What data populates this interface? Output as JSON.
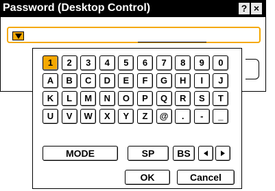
{
  "dialog": {
    "title": "Password (Desktop Control)",
    "help_label": "?",
    "close_label": "×"
  },
  "keyboard": {
    "row1": [
      "1",
      "2",
      "3",
      "4",
      "5",
      "6",
      "7",
      "8",
      "9",
      "0"
    ],
    "row2": [
      "A",
      "B",
      "C",
      "D",
      "E",
      "F",
      "G",
      "H",
      "I",
      "J"
    ],
    "row3": [
      "K",
      "L",
      "M",
      "N",
      "O",
      "P",
      "Q",
      "R",
      "S",
      "T"
    ],
    "row4": [
      "U",
      "V",
      "W",
      "X",
      "Y",
      "Z",
      "@",
      ".",
      "-",
      "_"
    ],
    "selected": "1",
    "mode_label": "MODE",
    "sp_label": "SP",
    "bs_label": "BS",
    "ok_label": "OK",
    "cancel_label": "Cancel"
  },
  "colors": {
    "accent": "#f5a800",
    "titlebar": "#000000"
  },
  "icons": {
    "caret": "dropdown-triangle-icon",
    "left": "arrow-left-icon",
    "right": "arrow-right-icon"
  }
}
